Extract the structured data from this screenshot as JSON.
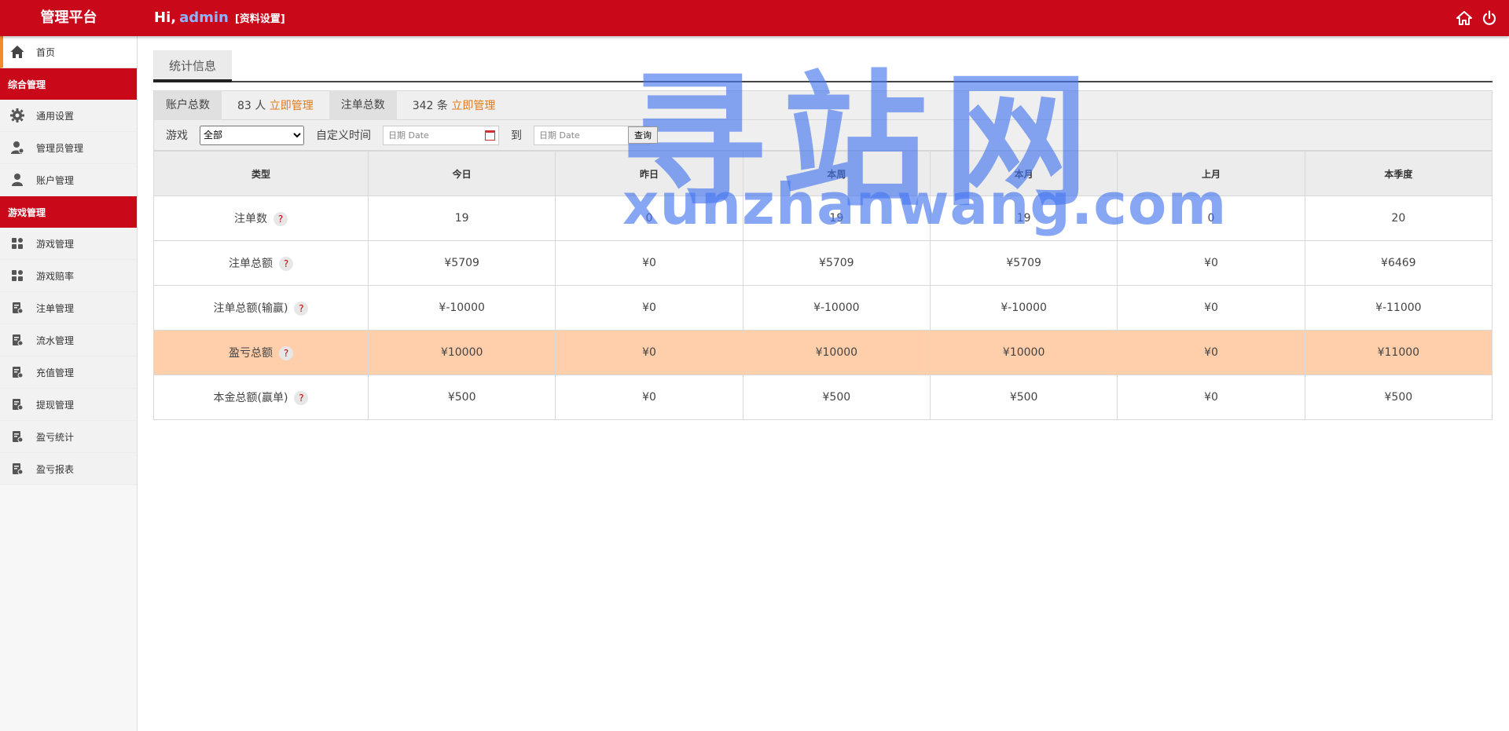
{
  "header": {
    "brand": "管理平台",
    "greeting": "Hi,",
    "username": "admin",
    "settings_link": "[资料设置]"
  },
  "sidebar": {
    "home": "首页",
    "groups": [
      {
        "title": "综合管理",
        "items": [
          {
            "label": "通用设置",
            "icon": "gear-icon"
          },
          {
            "label": "管理员管理",
            "icon": "admin-user-icon"
          },
          {
            "label": "账户管理",
            "icon": "user-icon"
          }
        ]
      },
      {
        "title": "游戏管理",
        "items": [
          {
            "label": "游戏管理",
            "icon": "apps-icon"
          },
          {
            "label": "游戏赔率",
            "icon": "apps-icon"
          },
          {
            "label": "注单管理",
            "icon": "report-icon"
          },
          {
            "label": "流水管理",
            "icon": "report-icon"
          },
          {
            "label": "充值管理",
            "icon": "report-icon"
          },
          {
            "label": "提现管理",
            "icon": "report-icon"
          },
          {
            "label": "盈亏统计",
            "icon": "report-icon"
          },
          {
            "label": "盈亏报表",
            "icon": "report-icon"
          }
        ]
      }
    ]
  },
  "main": {
    "tab": "统计信息",
    "summary": {
      "accounts_label": "账户总数",
      "accounts_value": "83 人",
      "accounts_link": "立即管理",
      "orders_label": "注单总数",
      "orders_value": "342 条",
      "orders_link": "立即管理"
    },
    "filters": {
      "game_label": "游戏",
      "game_selected": "全部",
      "custom_time_label": "自定义时间",
      "date_placeholder": "日期 Date",
      "to_label": "到",
      "query_button": "查询"
    },
    "table": {
      "headers": [
        "类型",
        "今日",
        "昨日",
        "本周",
        "本月",
        "上月",
        "本季度"
      ],
      "rows": [
        {
          "cells": [
            "注单数",
            "19",
            "0",
            "19",
            "19",
            "0",
            "20"
          ],
          "highlight": false
        },
        {
          "cells": [
            "注单总额",
            "¥5709",
            "¥0",
            "¥5709",
            "¥5709",
            "¥0",
            "¥6469"
          ],
          "highlight": false
        },
        {
          "cells": [
            "注单总额(输赢)",
            "¥-10000",
            "¥0",
            "¥-10000",
            "¥-10000",
            "¥0",
            "¥-11000"
          ],
          "highlight": false
        },
        {
          "cells": [
            "盈亏总额",
            "¥10000",
            "¥0",
            "¥10000",
            "¥10000",
            "¥0",
            "¥11000"
          ],
          "highlight": true
        },
        {
          "cells": [
            "本金总额(赢单)",
            "¥500",
            "¥0",
            "¥500",
            "¥500",
            "¥0",
            "¥500"
          ],
          "highlight": false
        }
      ],
      "help_mark": "?"
    }
  },
  "watermark": {
    "cn": "寻站网",
    "en": "xunzhanwang.com"
  },
  "colors": {
    "brand_red": "#c9081a",
    "link_orange": "#e07a1a",
    "highlight_row": "#ffceaa",
    "watermark_blue": "#4678f0"
  }
}
